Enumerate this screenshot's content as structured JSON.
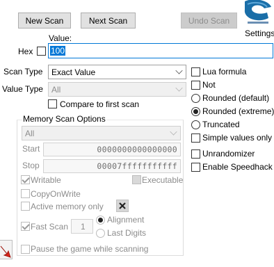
{
  "toolbar": {
    "new_scan": "New Scan",
    "next_scan": "Next Scan",
    "undo_scan": "Undo Scan",
    "settings": "Settings"
  },
  "value": {
    "label": "Value:",
    "hex_label": "Hex",
    "input_value": "100"
  },
  "scan_type": {
    "label": "Scan Type",
    "selected": "Exact Value"
  },
  "value_type": {
    "label": "Value Type",
    "selected": "All"
  },
  "compare_first": "Compare to first scan",
  "memory_options": {
    "title": "Memory Scan Options",
    "region": "All",
    "start_label": "Start",
    "start_value": "0000000000000000",
    "stop_label": "Stop",
    "stop_value": "00007fffffffffff",
    "writable": "Writable",
    "executable": "Executable",
    "copy_on_write": "CopyOnWrite",
    "active_memory": "Active memory only",
    "fast_scan": "Fast Scan",
    "fast_scan_value": "1",
    "alignment": "Alignment",
    "last_digits": "Last Digits",
    "pause_game": "Pause the game while scanning"
  },
  "right_options": {
    "lua_formula": "Lua formula",
    "not": "Not",
    "rounded_default": "Rounded (default)",
    "rounded_extreme": "Rounded (extreme)",
    "truncated": "Truncated",
    "simple_values": "Simple values only",
    "unrandomizer": "Unrandomizer",
    "enable_speedhack": "Enable Speedhack"
  },
  "colors": {
    "selection": "#0078d7",
    "logo": "#1a6ea8",
    "arrow": "#d9261c"
  }
}
